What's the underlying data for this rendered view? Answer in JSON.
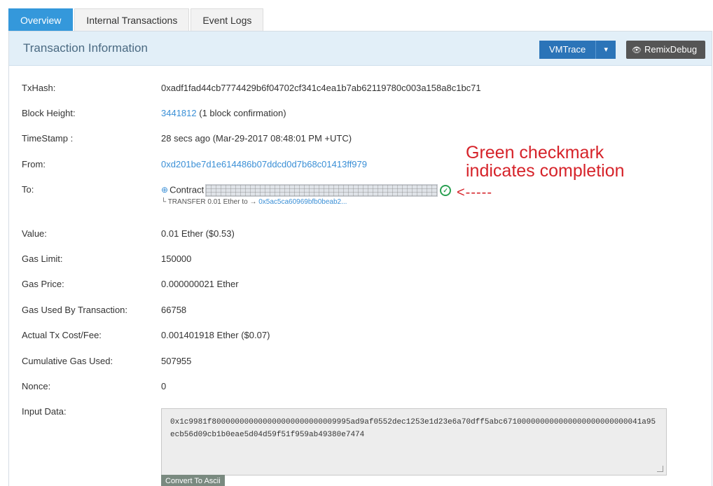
{
  "tabs": [
    {
      "label": "Overview",
      "active": true
    },
    {
      "label": "Internal Transactions",
      "active": false
    },
    {
      "label": "Event Logs",
      "active": false
    }
  ],
  "panel": {
    "title": "Transaction Information",
    "vmtrace_label": "VMTrace",
    "vmtrace_caret": "▾",
    "remix_label": "RemixDebug"
  },
  "fields": {
    "txhash": {
      "label": "TxHash:",
      "value": "0xadf1fad44cb7774429b6f04702cf341c4ea1b7ab62119780c003a158a8c1bc71"
    },
    "block_height": {
      "label": "Block Height:",
      "value": "3441812",
      "suffix": "(1 block confirmation)"
    },
    "timestamp": {
      "label": "TimeStamp :",
      "value": "28 secs ago (Mar-29-2017 08:48:01 PM +UTC)"
    },
    "from": {
      "label": "From:",
      "value": "0xd201be7d1e614486b07ddcd0d7b68c01413ff979"
    },
    "to": {
      "label": "To:",
      "contract": "Contract",
      "transfer_label": "TRANSFER",
      "transfer_amount": "0.01 Ether",
      "transfer_to": "to",
      "transfer_address": "0x5ac5ca60969bfb0beab2..."
    },
    "value": {
      "label": "Value:",
      "value": "0.01 Ether ($0.53)"
    },
    "gas_limit": {
      "label": "Gas Limit:",
      "value": "150000"
    },
    "gas_price": {
      "label": "Gas Price:",
      "value": "0.000000021 Ether"
    },
    "gas_used": {
      "label": "Gas Used By Transaction:",
      "value": "66758"
    },
    "tx_cost": {
      "label": "Actual Tx Cost/Fee:",
      "value": "0.001401918 Ether ($0.07)"
    },
    "cumulative_gas": {
      "label": "Cumulative Gas Used:",
      "value": "507955"
    },
    "nonce": {
      "label": "Nonce:",
      "value": "0"
    },
    "input_data": {
      "label": "Input Data:",
      "value": "0x1c9981f800000000000000000000000009995ad9af0552dec1253e1d23e6a70dff5abc671000000000000000000000000041a95ecb56d09cb1b0eae5d04d59f51f959ab49380e7474",
      "button": "Convert To Ascii"
    }
  },
  "annotation": {
    "line1": "Green checkmark",
    "line2": "indicates completion",
    "arrow": "<-----"
  }
}
